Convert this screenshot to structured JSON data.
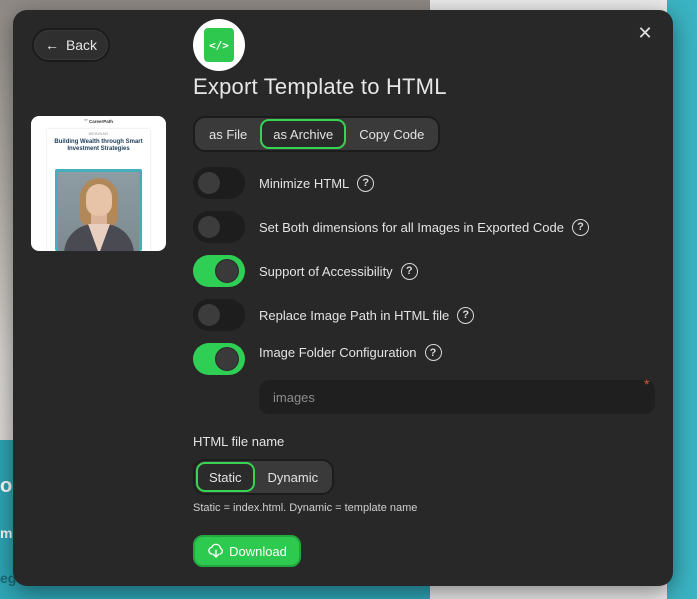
{
  "background": {
    "text_1": "os",
    "text_2": "m",
    "text_3": "eg"
  },
  "modal": {
    "back_label": "Back",
    "close_glyph": "✕",
    "title": "Export Template to HTML",
    "app_icon_glyph": "</>",
    "preview": {
      "brand": "⁗ CareerPath",
      "tag": "WEBINAR",
      "heading": "Building Wealth through Smart Investment Strategies"
    },
    "export_modes": {
      "items": [
        "as File",
        "as Archive",
        "Copy Code"
      ],
      "selected": "as Archive"
    },
    "options": [
      {
        "label": "Minimize HTML",
        "enabled": false
      },
      {
        "label": "Set Both dimensions for all Images in Exported Code",
        "enabled": false
      },
      {
        "label": "Support of Accessibility",
        "enabled": true
      },
      {
        "label": "Replace Image Path in HTML file",
        "enabled": false
      },
      {
        "label": "Image Folder Configuration",
        "enabled": true
      }
    ],
    "help_glyph": "?",
    "image_folder": {
      "value": "",
      "placeholder": "images",
      "required_mark": "*"
    },
    "file_name": {
      "label": "HTML file name",
      "items": [
        "Static",
        "Dynamic"
      ],
      "selected": "Static",
      "hint": "Static = index.html. Dynamic = template name"
    },
    "download_label": "Download"
  },
  "colors": {
    "modal_bg": "#282828",
    "accent_green": "#2fcf55",
    "active_outline": "#39d353"
  },
  "icons": {
    "back": "arrow-left-icon",
    "close": "close-icon",
    "app": "code-file-icon",
    "help": "help-circle-icon",
    "download": "cloud-download-icon"
  }
}
